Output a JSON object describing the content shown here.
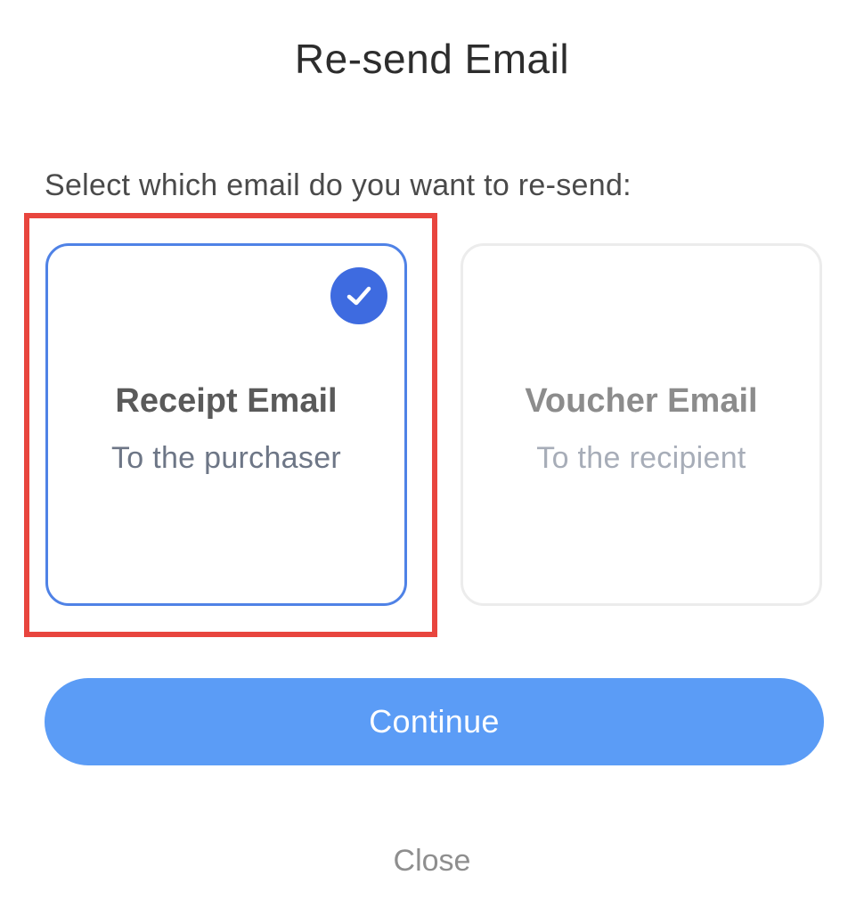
{
  "dialog": {
    "title": "Re-send Email",
    "prompt": "Select which email do you want to re-send:"
  },
  "options": [
    {
      "title": "Receipt Email",
      "subtitle": "To the purchaser",
      "selected": true,
      "icon": "check-icon"
    },
    {
      "title": "Voucher Email",
      "subtitle": "To the recipient",
      "selected": false
    }
  ],
  "actions": {
    "continue_label": "Continue",
    "close_label": "Close"
  },
  "colors": {
    "accent": "#3e6be0",
    "selected_border": "#4f82e6",
    "button": "#5b9cf6",
    "highlight": "#e8453e"
  }
}
